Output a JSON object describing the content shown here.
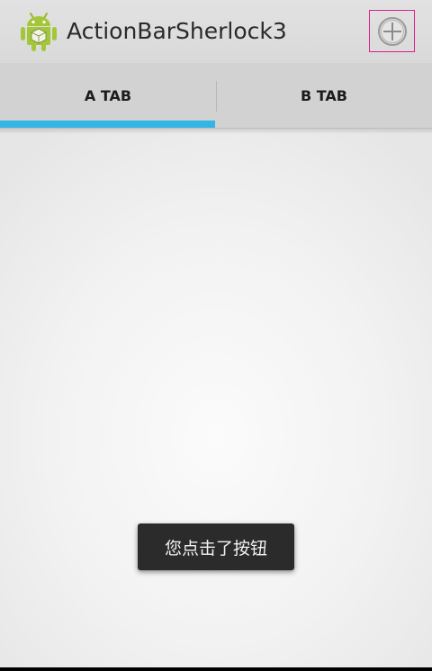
{
  "action_bar": {
    "title": "ActionBarSherlock3",
    "app_icon": "android-icon",
    "add_action_icon": "add-circle-icon"
  },
  "tabs": [
    {
      "label": "A TAB",
      "selected": true
    },
    {
      "label": "B TAB",
      "selected": false
    }
  ],
  "toast": {
    "message": "您点击了按钮"
  },
  "colors": {
    "accent_indicator": "#33b5e5",
    "action_bar_bg": "#dcdcdc",
    "tab_bar_bg": "#d2d2d2",
    "toast_bg": "#2b2b2b",
    "android_green": "#a4c639",
    "highlight_border": "#e0208c"
  }
}
